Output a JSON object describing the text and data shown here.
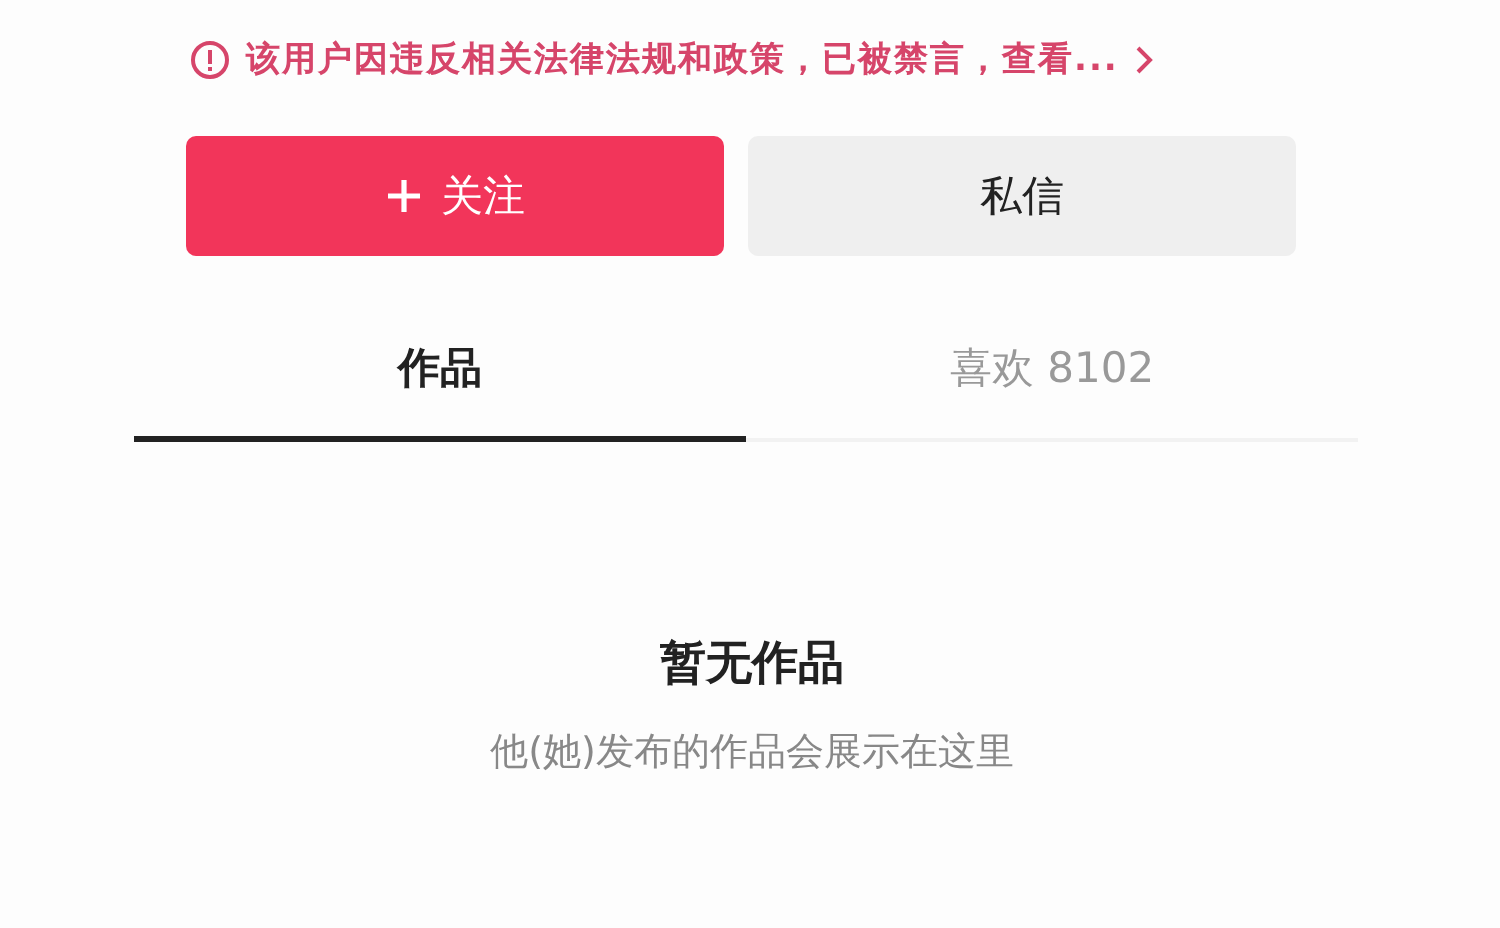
{
  "notice": {
    "text": "该用户因违反相关法律法规和政策，已被禁言，查看..."
  },
  "buttons": [
    {
      "kind": "follow",
      "label": "关注"
    },
    {
      "kind": "message",
      "label": "私信"
    }
  ],
  "tabs": [
    {
      "label": "作品",
      "selected": true
    },
    {
      "label": "喜欢 8102",
      "selected": false
    }
  ],
  "empty": {
    "title": "暂无作品",
    "subtitle": "他(她)发布的作品会展示在这里"
  }
}
